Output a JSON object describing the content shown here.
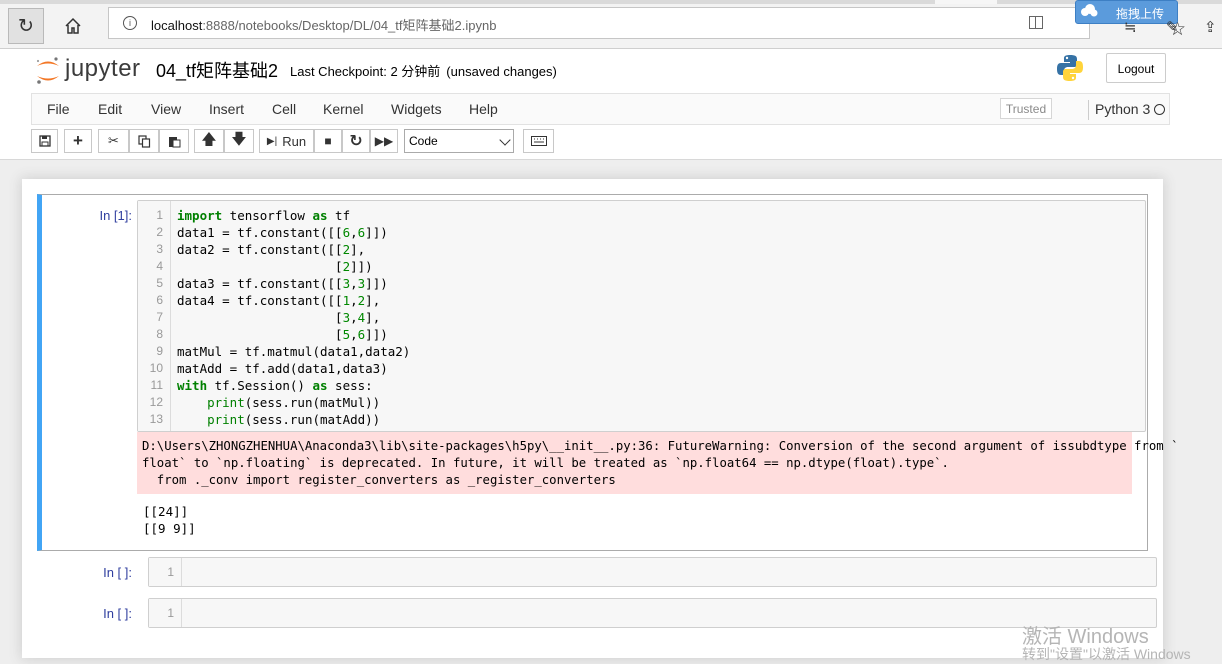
{
  "browser": {
    "url_host": "localhost",
    "url_path": ":8888/notebooks/Desktop/DL/04_tf矩阵基础2.ipynb",
    "upload_label": "拖拽上传"
  },
  "header": {
    "logo_text": "jupyter",
    "notebook_title": "04_tf矩阵基础2",
    "checkpoint_text": "Last Checkpoint: 2 分钟前",
    "unsaved_text": "(unsaved changes)",
    "logout_label": "Logout"
  },
  "menu": {
    "items": [
      "File",
      "Edit",
      "View",
      "Insert",
      "Cell",
      "Kernel",
      "Widgets",
      "Help"
    ],
    "trusted_label": "Trusted",
    "kernel_name": "Python 3"
  },
  "toolbar": {
    "run_label": "Run",
    "cell_type": "Code"
  },
  "cells": [
    {
      "prompt": "In [1]:",
      "line_numbers": [
        "1",
        "2",
        "3",
        "4",
        "5",
        "6",
        "7",
        "8",
        "9",
        "10",
        "11",
        "12",
        "13"
      ],
      "stderr": "D:\\Users\\ZHONGZHENHUA\\Anaconda3\\lib\\site-packages\\h5py\\__init__.py:36: FutureWarning: Conversion of the second argument of issubdtype from `\nfloat` to `np.floating` is deprecated. In future, it will be treated as `np.float64 == np.dtype(float).type`.\n  from ._conv import register_converters as _register_converters",
      "stdout": "[[24]]\n[[9 9]]"
    },
    {
      "prompt": "In [ ]:",
      "line_numbers": [
        "1"
      ]
    },
    {
      "prompt": "In [ ]:",
      "line_numbers": [
        "1"
      ]
    }
  ],
  "watermark": {
    "title": "激活 Windows",
    "subtitle": "转到\"设置\"以激活 Windows"
  }
}
